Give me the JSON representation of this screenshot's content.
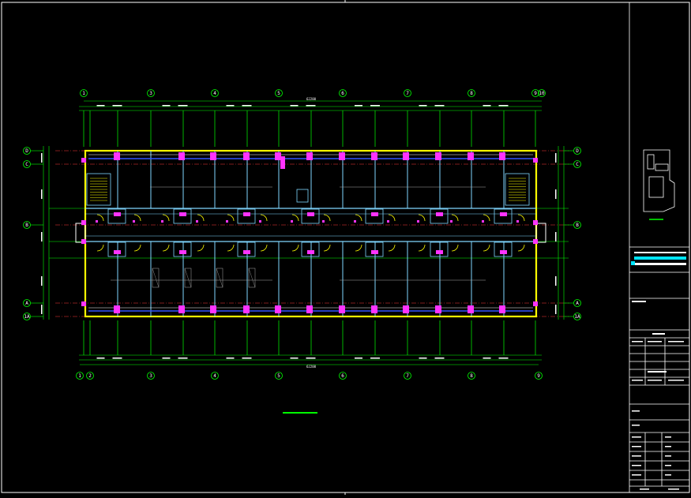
{
  "drawing": {
    "background": "#000000",
    "colors": {
      "frame": "#ffffff",
      "axis_line": "#ff3b3b",
      "dimension": "#00ff00",
      "wall": "#ffff00",
      "structure": "#7fd6ff",
      "fixture": "#ff33ff",
      "pipe": "#3355ff",
      "annotation": "#ffffff"
    },
    "top_axes": [
      "1",
      "3",
      "4",
      "5",
      "6",
      "7",
      "8",
      "9",
      "10"
    ],
    "bottom_axes": [
      "1",
      "2",
      "3",
      "4",
      "5",
      "6",
      "7",
      "8",
      "9",
      "10"
    ],
    "left_axes": [
      "D",
      "C",
      "B",
      "A",
      "1A"
    ],
    "right_axes": [
      "D",
      "C",
      "B",
      "A",
      "1A"
    ],
    "overall_dimension": "62200"
  }
}
